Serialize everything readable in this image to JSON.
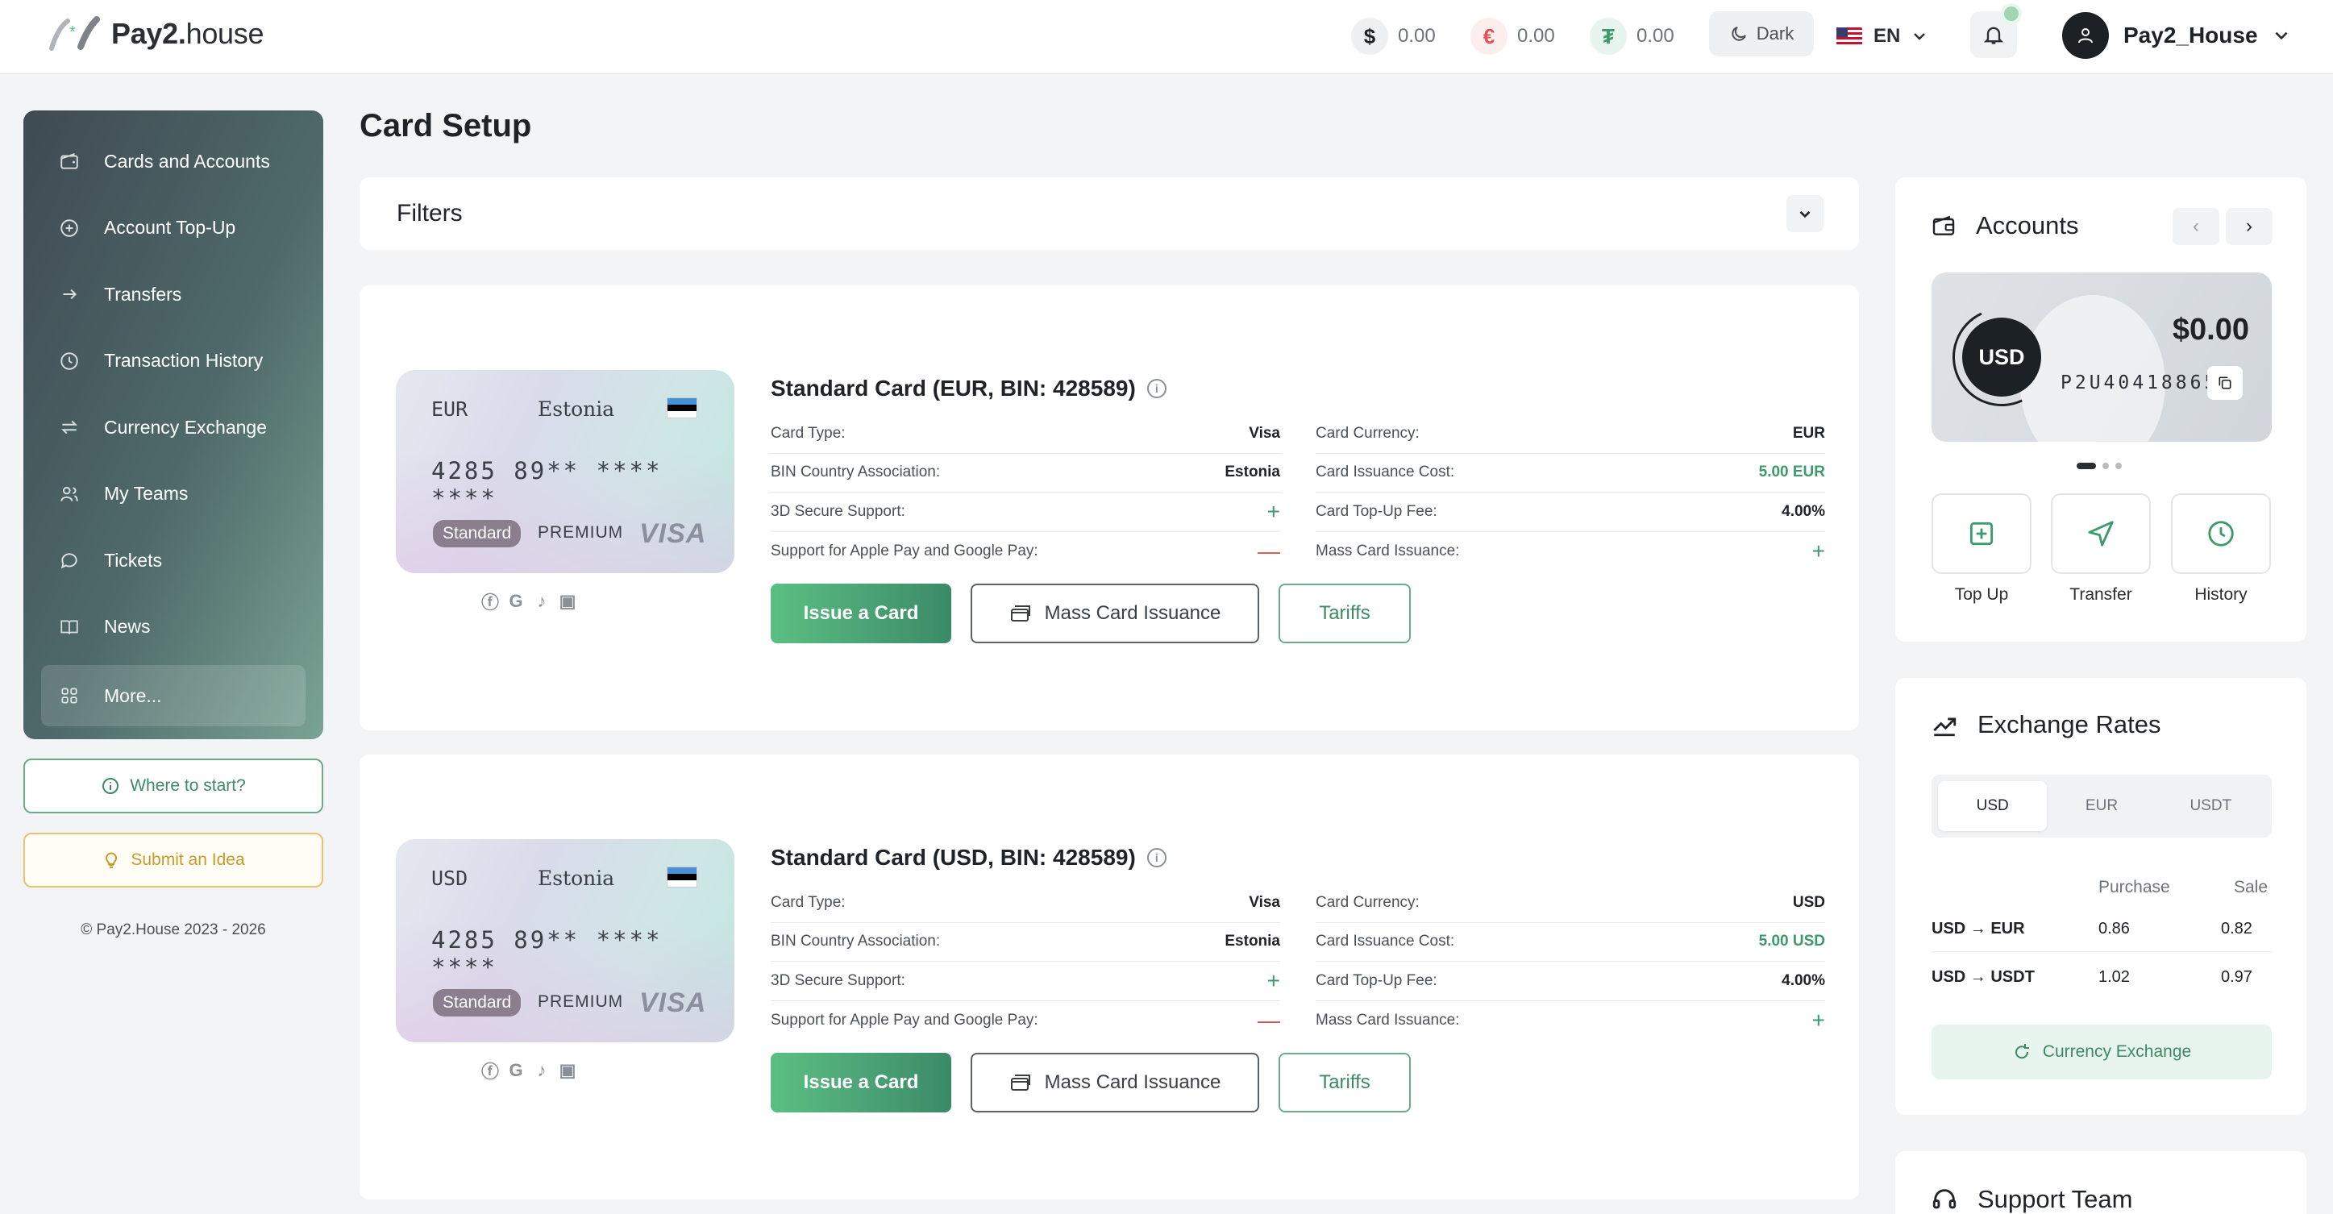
{
  "header": {
    "logo_bold": "Pay2.",
    "logo_light": "house",
    "balances": [
      {
        "symbol": "$",
        "value": "0.00",
        "color": "#1f2328",
        "bg": "#eef0f2"
      },
      {
        "symbol": "€",
        "value": "0.00",
        "color": "#e05353",
        "bg": "#fdeeee"
      },
      {
        "symbol": "₮",
        "value": "0.00",
        "color": "#3d9a6a",
        "bg": "#e8f5ee"
      }
    ],
    "theme_label": "Dark",
    "language": "EN",
    "username": "Pay2_House"
  },
  "sidebar": {
    "items": [
      {
        "label": "Cards and Accounts",
        "icon": "wallet-icon"
      },
      {
        "label": "Account Top-Up",
        "icon": "plus-circle-icon"
      },
      {
        "label": "Transfers",
        "icon": "arrow-right-icon"
      },
      {
        "label": "Transaction History",
        "icon": "clock-icon"
      },
      {
        "label": "Currency Exchange",
        "icon": "swap-icon"
      },
      {
        "label": "My Teams",
        "icon": "users-icon"
      },
      {
        "label": "Tickets",
        "icon": "chat-icon"
      },
      {
        "label": "News",
        "icon": "book-icon"
      },
      {
        "label": "More...",
        "icon": "grid-icon"
      }
    ],
    "where_to_start": "Where to start?",
    "submit_idea": "Submit an Idea",
    "copyright": "© Pay2.House 2023 - 2026"
  },
  "main": {
    "title": "Card Setup",
    "filters_label": "Filters",
    "cards": [
      {
        "title": "Standard Card (EUR, BIN: 428589)",
        "image": {
          "currency": "EUR",
          "country": "Estonia",
          "number": "4285 89** **** ****",
          "tag": "Standard",
          "tier": "PREMIUM",
          "brand": "VISA"
        },
        "left_specs": [
          {
            "label": "Card Type:",
            "value": "Visa"
          },
          {
            "label": "BIN Country Association:",
            "value": "Estonia"
          },
          {
            "label": "3D Secure Support:",
            "value": "+"
          },
          {
            "label": "Support for Apple Pay and Google Pay:",
            "value": "—"
          }
        ],
        "right_specs": [
          {
            "label": "Card Currency:",
            "value": "EUR"
          },
          {
            "label": "Card Issuance Cost:",
            "value": "5.00 EUR"
          },
          {
            "label": "Card Top-Up Fee:",
            "value": "4.00%"
          },
          {
            "label": "Mass Card Issuance:",
            "value": "+"
          }
        ]
      },
      {
        "title": "Standard Card (USD, BIN: 428589)",
        "image": {
          "currency": "USD",
          "country": "Estonia",
          "number": "4285 89** **** ****",
          "tag": "Standard",
          "tier": "PREMIUM",
          "brand": "VISA"
        },
        "left_specs": [
          {
            "label": "Card Type:",
            "value": "Visa"
          },
          {
            "label": "BIN Country Association:",
            "value": "Estonia"
          },
          {
            "label": "3D Secure Support:",
            "value": "+"
          },
          {
            "label": "Support for Apple Pay and Google Pay:",
            "value": "—"
          }
        ],
        "right_specs": [
          {
            "label": "Card Currency:",
            "value": "USD"
          },
          {
            "label": "Card Issuance Cost:",
            "value": "5.00 USD"
          },
          {
            "label": "Card Top-Up Fee:",
            "value": "4.00%"
          },
          {
            "label": "Mass Card Issuance:",
            "value": "+"
          }
        ]
      }
    ],
    "buttons": {
      "issue": "Issue a Card",
      "mass": "Mass Card Issuance",
      "tariffs": "Tariffs"
    }
  },
  "accounts": {
    "title": "Accounts",
    "currency": "USD",
    "amount": "$0.00",
    "account_id": "P2U40418865",
    "actions": [
      "Top Up",
      "Transfer",
      "History"
    ]
  },
  "exchange_rates": {
    "title": "Exchange Rates",
    "tabs": [
      "USD",
      "EUR",
      "USDT"
    ],
    "active_tab": "USD",
    "columns": {
      "purchase": "Purchase",
      "sale": "Sale"
    },
    "rows": [
      {
        "pair": "USD → EUR",
        "purchase": "0.86",
        "sale": "0.82"
      },
      {
        "pair": "USD → USDT",
        "purchase": "1.02",
        "sale": "0.97"
      }
    ],
    "exchange_button": "Currency Exchange"
  },
  "support": {
    "title": "Support Team"
  }
}
